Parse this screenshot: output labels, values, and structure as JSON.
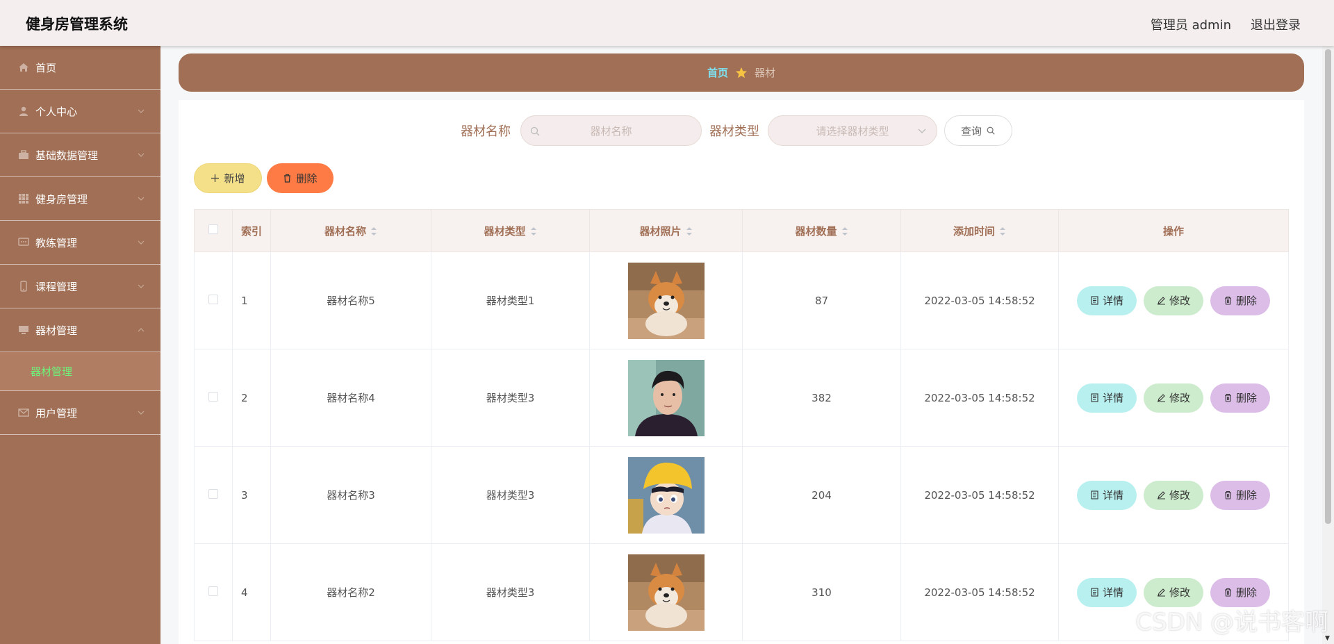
{
  "header": {
    "title": "健身房管理系统",
    "user": "管理员 admin",
    "logout": "退出登录"
  },
  "sidebar": {
    "items": [
      {
        "label": "首页",
        "icon": "home-icon"
      },
      {
        "label": "个人中心",
        "icon": "user-icon"
      },
      {
        "label": "基础数据管理",
        "icon": "briefcase-icon"
      },
      {
        "label": "健身房管理",
        "icon": "grid-icon"
      },
      {
        "label": "教练管理",
        "icon": "chat-icon"
      },
      {
        "label": "课程管理",
        "icon": "mobile-icon"
      },
      {
        "label": "器材管理",
        "icon": "monitor-icon",
        "expanded": true,
        "children": [
          "器材管理"
        ]
      },
      {
        "label": "用户管理",
        "icon": "mail-icon"
      }
    ]
  },
  "breadcrumb": {
    "home": "首页",
    "current": "器材"
  },
  "search": {
    "name_label": "器材名称",
    "name_placeholder": "器材名称",
    "type_label": "器材类型",
    "type_placeholder": "请选择器材类型",
    "query_label": "查询"
  },
  "actions": {
    "add_label": "新增",
    "delete_label": "删除"
  },
  "table": {
    "columns": [
      "索引",
      "器材名称",
      "器材类型",
      "器材照片",
      "器材数量",
      "添加时间",
      "操作"
    ],
    "rows": [
      {
        "index": "1",
        "name": "器材名称5",
        "type": "器材类型1",
        "photo": "shiba-dog-photo",
        "quantity": "87",
        "time": "2022-03-05 14:58:52"
      },
      {
        "index": "2",
        "name": "器材名称4",
        "type": "器材类型3",
        "photo": "young-man-portrait",
        "quantity": "382",
        "time": "2022-03-05 14:58:52"
      },
      {
        "index": "3",
        "name": "器材名称3",
        "type": "器材类型3",
        "photo": "anime-boy-yellow-hat",
        "quantity": "204",
        "time": "2022-03-05 14:58:52"
      },
      {
        "index": "4",
        "name": "器材名称2",
        "type": "器材类型3",
        "photo": "shiba-dog-photo",
        "quantity": "310",
        "time": "2022-03-05 14:58:52"
      }
    ],
    "row_buttons": {
      "detail": "详情",
      "edit": "修改",
      "delete": "删除"
    }
  },
  "watermark": "CSDN @说书客啊",
  "colors": {
    "sidebar": "#a06f55",
    "accent_text": "#a06f55",
    "submenu_active": "#6ef27a",
    "add_button": "#f5e08a",
    "delete_button": "#fe7b45",
    "detail_button": "#b8f0f0",
    "edit_button": "#cdeccd",
    "remove_button": "#dcbde8"
  }
}
